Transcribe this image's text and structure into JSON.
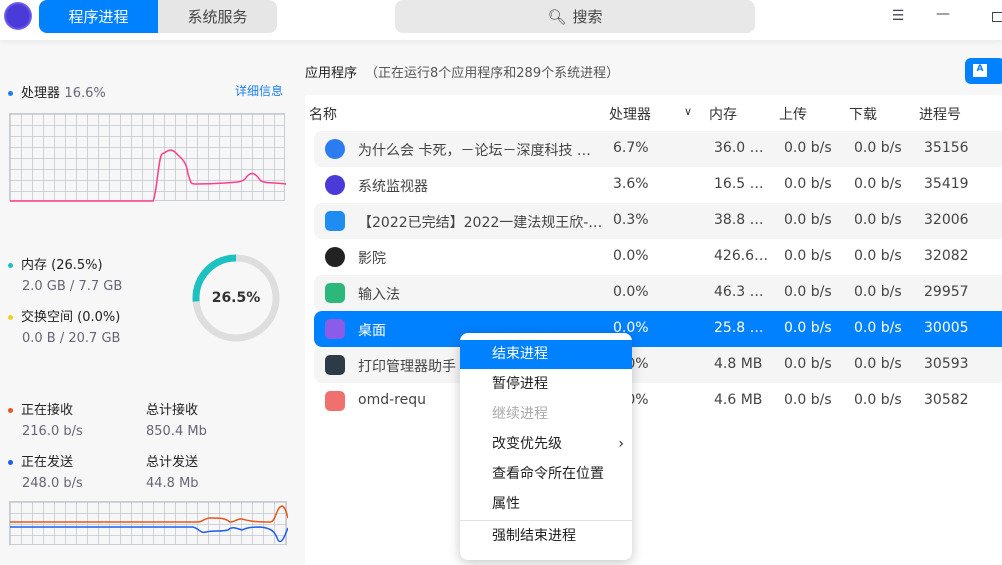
{
  "header": {
    "tabs": [
      "程序进程",
      "系统服务"
    ],
    "search_placeholder": "搜索"
  },
  "left": {
    "cpu": {
      "label": "处理器",
      "value": "16.6%",
      "detail_link": "详细信息"
    },
    "memory": {
      "label": "内存 (26.5%)",
      "value": "2.0 GB / 7.7 GB",
      "donut_text": "26.5%",
      "percent": 26.5
    },
    "swap": {
      "label": "交换空间 (0.0%)",
      "value": "0.0 B / 20.7 GB"
    },
    "network": {
      "recv_label": "正在接收",
      "recv_value": "216.0 b/s",
      "total_recv_label": "总计接收",
      "total_recv_value": "850.4 Mb",
      "send_label": "正在发送",
      "send_value": "248.0 b/s",
      "total_send_label": "总计发送",
      "total_send_value": "44.8 Mb"
    }
  },
  "main": {
    "title": "应用程序",
    "subtitle": "（正在运行8个应用程序和289个系统进程）",
    "columns": [
      "名称",
      "处理器",
      "内存",
      "上传",
      "下载",
      "进程号"
    ],
    "rows": [
      {
        "name": "为什么会 卡死，－论坛－深度科技 …",
        "cpu": "6.7%",
        "mem": "36.0 …",
        "up": "0.0 b/s",
        "down": "0.0 b/s",
        "pid": "35156",
        "icon": "browser-icon",
        "color": "#2a7cf0"
      },
      {
        "name": "系统监视器",
        "cpu": "3.6%",
        "mem": "16.5 …",
        "up": "0.0 b/s",
        "down": "0.0 b/s",
        "pid": "35419",
        "icon": "system-monitor-icon",
        "color": "#4a3ad8"
      },
      {
        "name": "【2022已完结】2022一建法规王欣-…",
        "cpu": "0.3%",
        "mem": "38.8 …",
        "up": "0.0 b/s",
        "down": "0.0 b/s",
        "pid": "32006",
        "icon": "document-app-icon",
        "color": "#1e8cf0"
      },
      {
        "name": "影院",
        "cpu": "0.0%",
        "mem": "426.6…",
        "up": "0.0 b/s",
        "down": "0.0 b/s",
        "pid": "32082",
        "icon": "movie-icon",
        "color": "#222"
      },
      {
        "name": "输入法",
        "cpu": "0.0%",
        "mem": "46.3 …",
        "up": "0.0 b/s",
        "down": "0.0 b/s",
        "pid": "29957",
        "icon": "input-method-icon",
        "color": "#2cb87a"
      },
      {
        "name": "桌面",
        "cpu": "0.0%",
        "mem": "25.8 …",
        "up": "0.0 b/s",
        "down": "0.0 b/s",
        "pid": "30005",
        "icon": "desktop-settings-icon",
        "color": "#8a5ce8"
      },
      {
        "name": "打印管理器助手",
        "cpu": "0.0%",
        "mem": "4.8 MB",
        "up": "0.0 b/s",
        "down": "0.0 b/s",
        "pid": "30593",
        "icon": "printer-icon",
        "color": "#2d3a48"
      },
      {
        "name": "omd-requ",
        "cpu": "0.0%",
        "mem": "4.6 MB",
        "up": "0.0 b/s",
        "down": "0.0 b/s",
        "pid": "30582",
        "icon": "omd-icon",
        "color": "#f07070"
      }
    ]
  },
  "context_menu": {
    "items": [
      "结束进程",
      "暂停进程",
      "继续进程",
      "改变优先级",
      "查看命令所在位置",
      "属性",
      "强制结束进程"
    ]
  },
  "colors": {
    "accent": "#0081ff",
    "cpu_line": "#ff3d8b",
    "recv": "#e8561e",
    "send": "#1e5ef0",
    "memory": "#1ec1c1"
  }
}
